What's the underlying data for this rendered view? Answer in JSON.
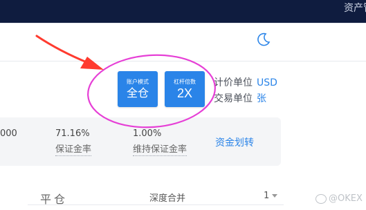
{
  "header": {
    "assets_label": "资产管"
  },
  "mode_button": {
    "small": "账户模式",
    "big": "全仓"
  },
  "leverage_button": {
    "small": "杠杆倍数",
    "big": "2X"
  },
  "units": [
    {
      "label": "计价单位",
      "value": "USD"
    },
    {
      "label": "交易单位",
      "value": "张"
    }
  ],
  "stats": {
    "partial_value": "000",
    "margin_ratio": {
      "value": "71.16%",
      "label": "保证金率"
    },
    "maintenance_margin_ratio": {
      "value": "1.00%",
      "label": "维持保证金率"
    }
  },
  "transfer_label": "资金划转",
  "close_label": "平仓",
  "depth_merge_label": "深度合并",
  "depth_value": "1",
  "watermark": "@OKEX",
  "colors": {
    "accent": "#2a84e8",
    "header_bg": "#0f1c3f",
    "annotation": "#e63fd6",
    "arrow": "#ff3b2f"
  },
  "icons": {
    "theme_toggle": "moon-icon",
    "annotation_arrow": "arrow-icon"
  }
}
